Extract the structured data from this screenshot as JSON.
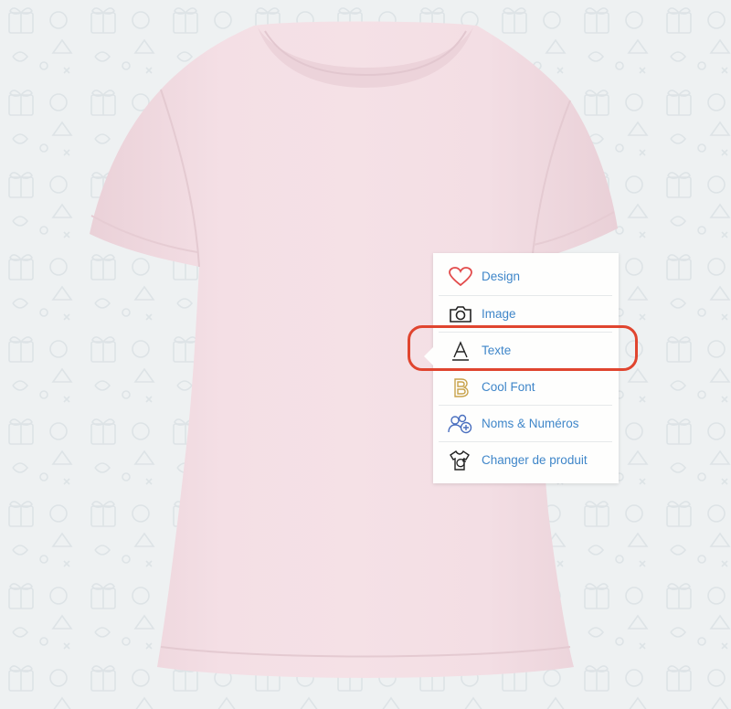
{
  "colors": {
    "background": "#eef1f2",
    "shirt": "#f3dde3",
    "label_blue": "#3f86c9",
    "highlight_red": "#e0452f",
    "heart_red": "#e24b4b",
    "cool_font_gold": "#c8a24a"
  },
  "product": {
    "name": "t-shirt"
  },
  "menu": {
    "items": [
      {
        "label": "Design",
        "icon": "heart-icon"
      },
      {
        "label": "Image",
        "icon": "camera-icon"
      },
      {
        "label": "Texte",
        "icon": "text-a-icon",
        "highlighted": true
      },
      {
        "label": "Cool Font",
        "icon": "cool-font-b-icon"
      },
      {
        "label": "Noms & Numéros",
        "icon": "names-numbers-icon"
      },
      {
        "label": "Changer de produit",
        "icon": "change-product-icon"
      }
    ]
  }
}
